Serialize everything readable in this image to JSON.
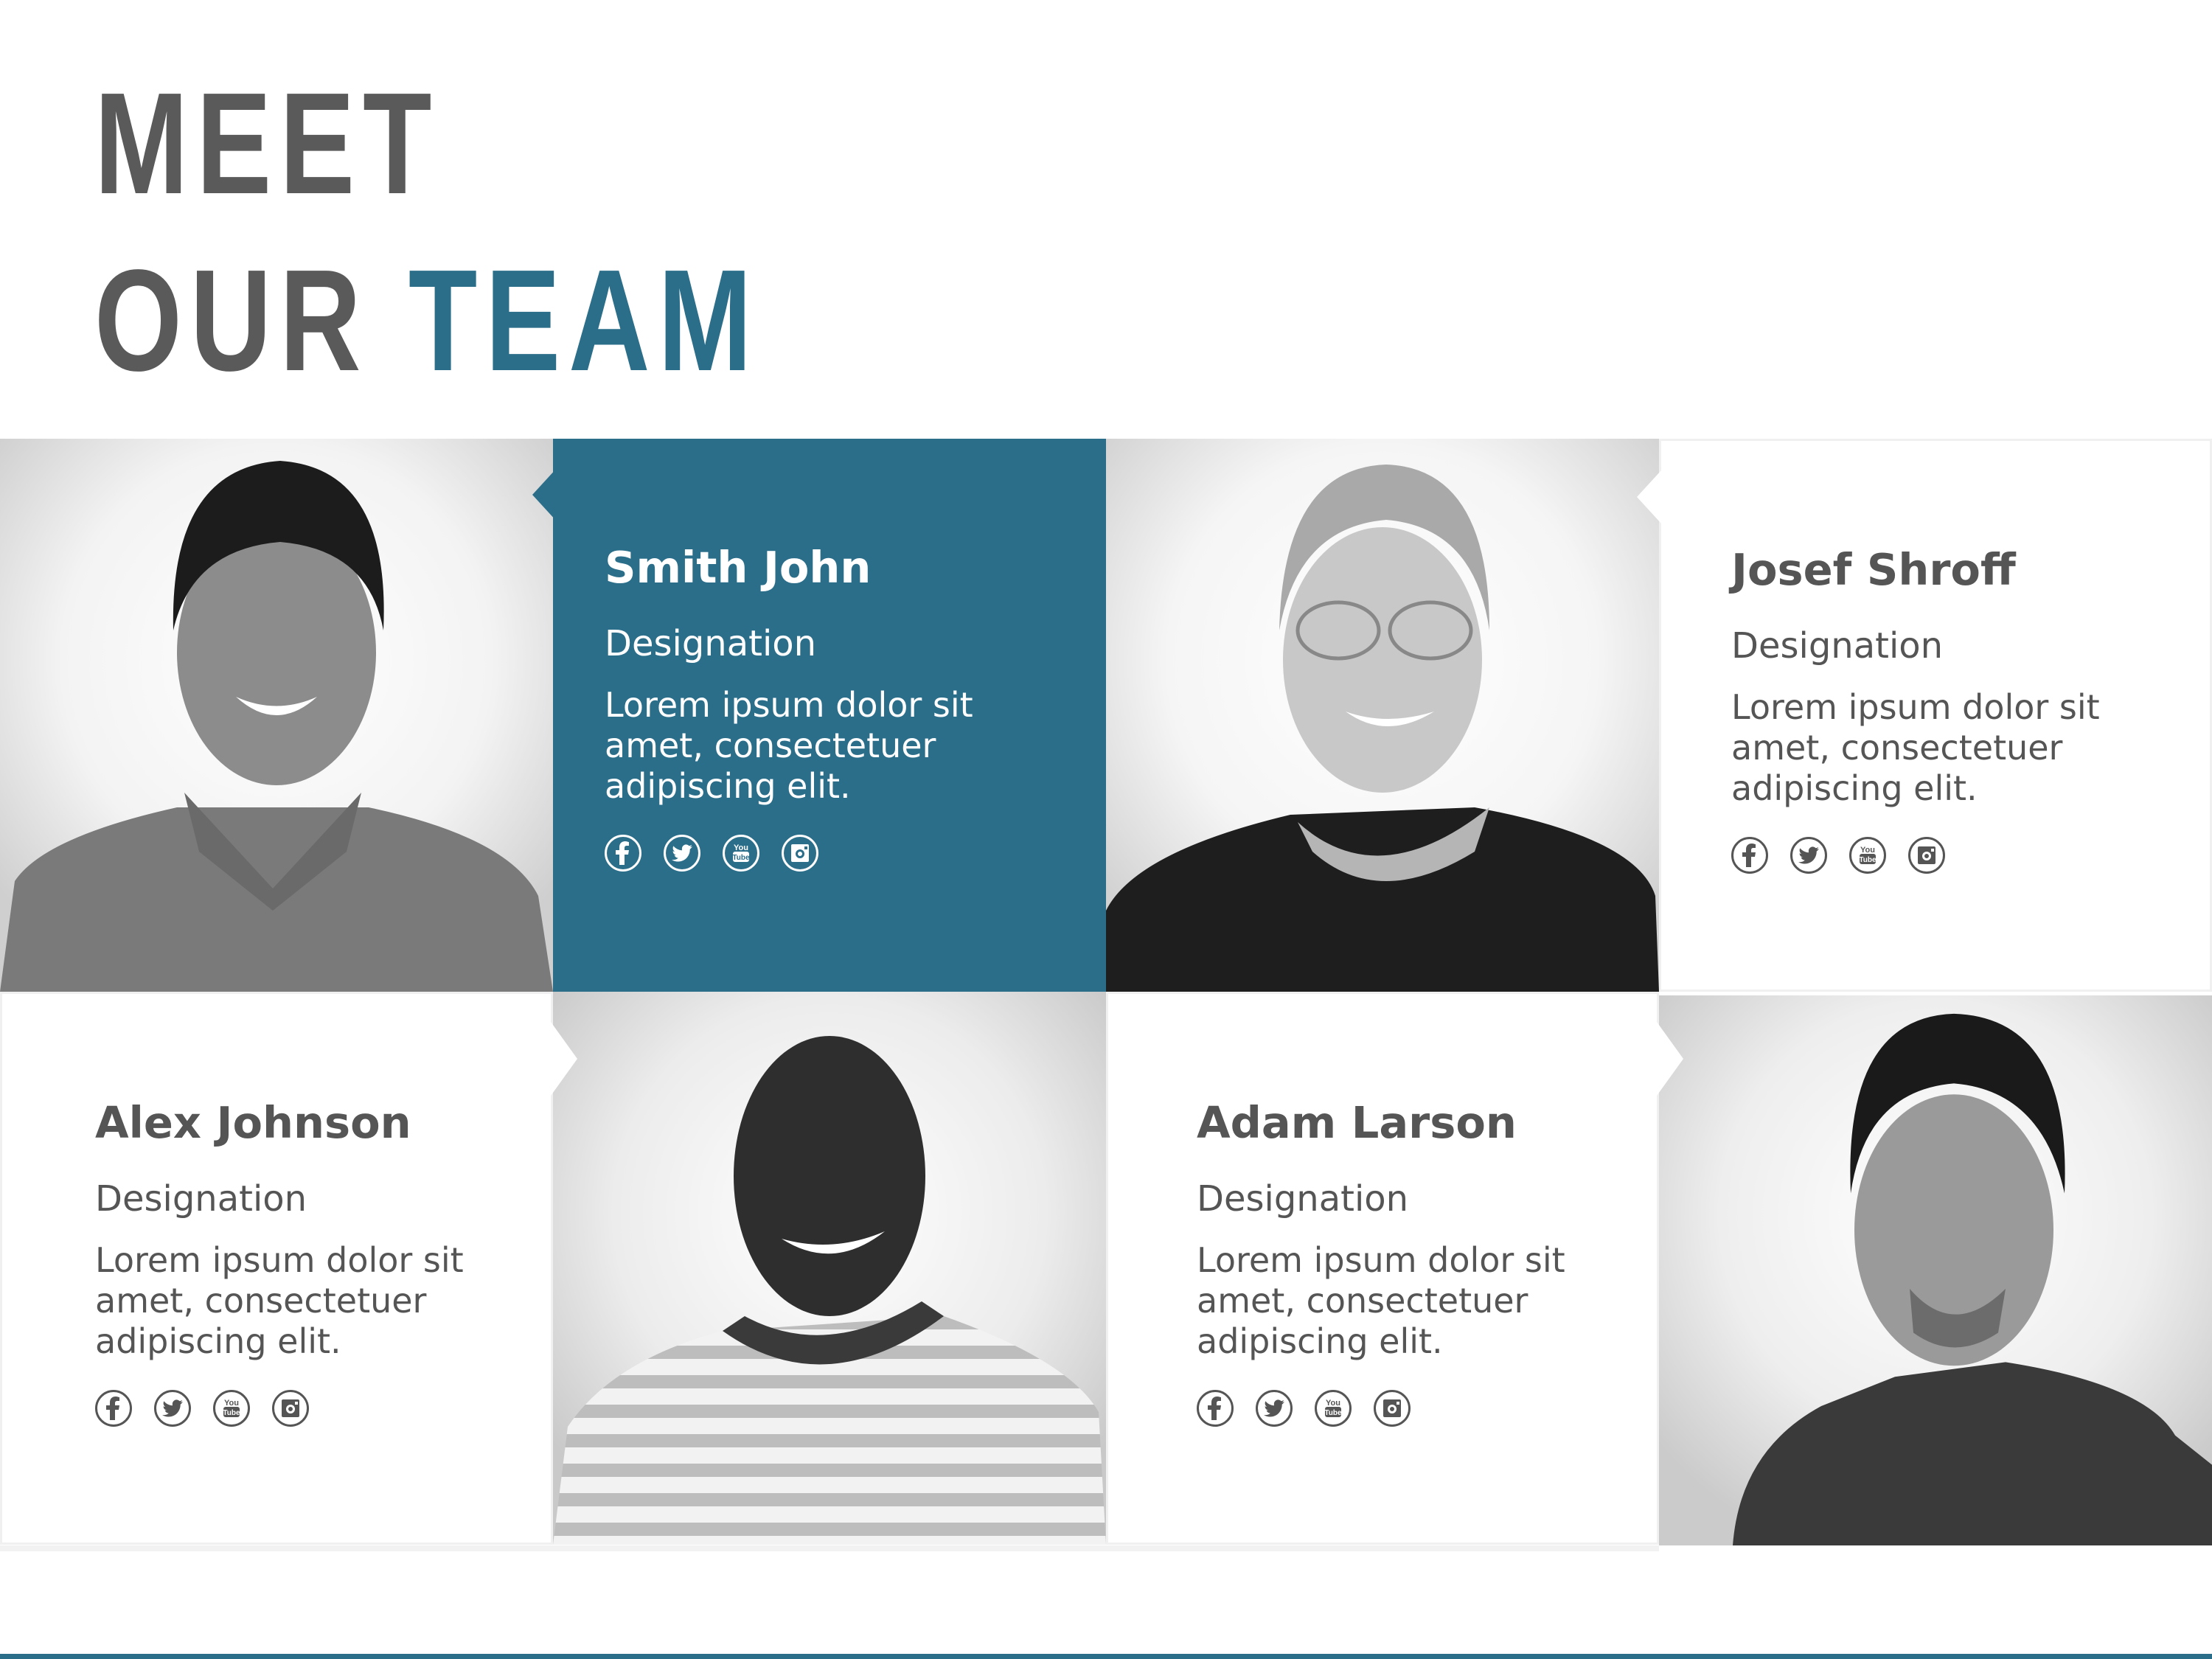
{
  "header": {
    "line1": "MEET",
    "line2_prefix": "OUR",
    "line2_accent": "TEAM"
  },
  "colors": {
    "accent": "#2b6e8a",
    "text": "#555555",
    "background": "#ffffff"
  },
  "team": [
    {
      "name": "Smith John",
      "designation": "Designation",
      "bio": "Lorem ipsum dolor sit amet, consectetuer adipiscing elit.",
      "photo": "portrait-young-man-polo",
      "highlighted": true
    },
    {
      "name": "Josef Shroff",
      "designation": "Designation",
      "bio": "Lorem ipsum dolor sit amet, consectetuer adipiscing elit.",
      "photo": "portrait-older-man-glasses",
      "highlighted": false
    },
    {
      "name": "Alex Johnson",
      "designation": "Designation",
      "bio": "Lorem ipsum dolor sit amet, consectetuer adipiscing elit.",
      "photo": "portrait-man-striped-shirt",
      "highlighted": false
    },
    {
      "name": "Adam Larson",
      "designation": "Designation",
      "bio": "Lorem ipsum dolor sit amet, consectetuer adipiscing elit.",
      "photo": "portrait-man-goatee-polo",
      "highlighted": false
    }
  ],
  "social_icons": [
    "facebook-icon",
    "twitter-icon",
    "youtube-icon",
    "instagram-icon"
  ]
}
